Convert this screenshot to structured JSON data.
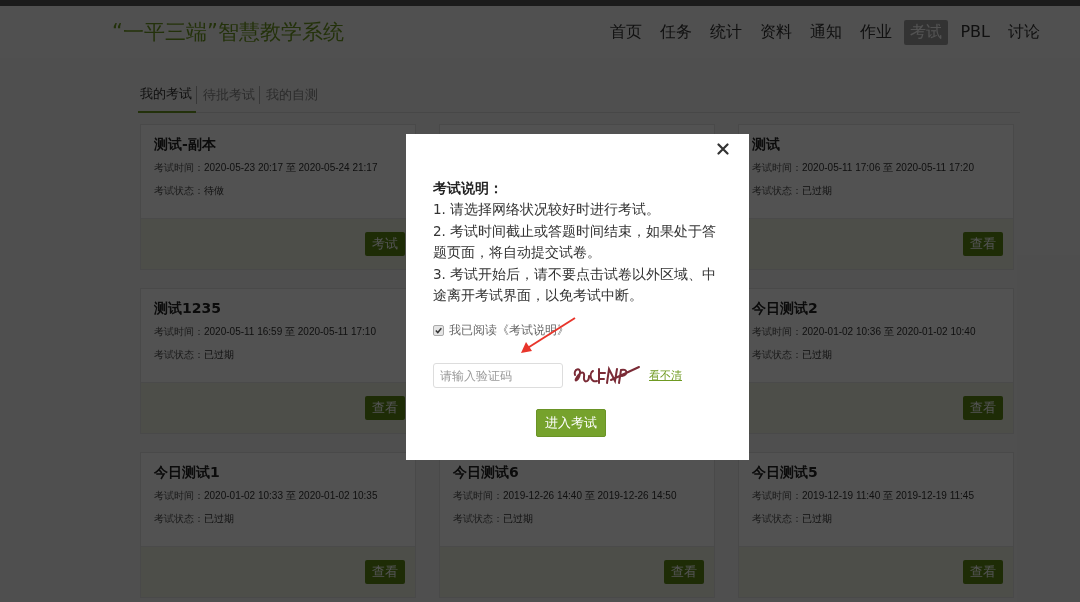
{
  "header": {
    "logo": "“一平三端”智慧教学系统",
    "nav": [
      {
        "label": "首页",
        "selected": false
      },
      {
        "label": "任务",
        "selected": false
      },
      {
        "label": "统计",
        "selected": false
      },
      {
        "label": "资料",
        "selected": false
      },
      {
        "label": "通知",
        "selected": false
      },
      {
        "label": "作业",
        "selected": false
      },
      {
        "label": "考试",
        "selected": true
      },
      {
        "label": "PBL",
        "selected": false
      },
      {
        "label": "讨论",
        "selected": false
      }
    ]
  },
  "tabs": [
    {
      "label": "我的考试",
      "selected": true
    },
    {
      "label": "待批考试",
      "selected": false
    },
    {
      "label": "我的自测",
      "selected": false
    }
  ],
  "exam_rows": [
    {
      "left": {
        "title": "测试-副本",
        "time_label": "考试时间：",
        "time": "2020-05-23 20:17 至 2020-05-24 21:17",
        "status_label": "考试状态：",
        "status": "待做",
        "button": "考试"
      },
      "right": {
        "title": "测试",
        "time_label": "考试时间：",
        "time": "2020-05-11 17:06 至 2020-05-11 17:20",
        "status_label": "考试状态：",
        "status": "已过期",
        "button": "查看"
      }
    },
    {
      "left": {
        "title": "测试1235",
        "time_label": "考试时间：",
        "time": "2020-05-11 16:59 至 2020-05-11 17:10",
        "status_label": "考试状态：",
        "status": "已过期",
        "button": "查看"
      },
      "right": {
        "title": "今日测试2",
        "time_label": "考试时间：",
        "time": "2020-01-02 10:36 至 2020-01-02 10:40",
        "status_label": "考试状态：",
        "status": "已过期",
        "button": "查看"
      }
    },
    {
      "left": {
        "title": "今日测试1",
        "time_label": "考试时间：",
        "time": "2020-01-02 10:33 至 2020-01-02 10:35",
        "status_label": "考试状态：",
        "status": "已过期",
        "button": "查看"
      },
      "middle": {
        "title": "今日测试6",
        "time_label": "考试时间：",
        "time": "2019-12-26 14:40 至 2019-12-26 14:50",
        "status_label": "考试状态：",
        "status": "已过期",
        "button": "查看"
      },
      "right": {
        "title": "今日测试5",
        "time_label": "考试时间：",
        "time": "2019-12-19 11:40 至 2019-12-19 11:45",
        "status_label": "考试状态：",
        "status": "已过期",
        "button": "查看"
      }
    }
  ],
  "dialog": {
    "heading": "考试说明：",
    "instructions": [
      "1. 请选择网络状况较好时进行考试。",
      "2. 考试时间截止或答题时间结束，如果处于答题页面，将自动提交试卷。",
      "3. 考试开始后，请不要点击试卷以外区域、中途离开考试界面，以免考试中断。"
    ],
    "agree": {
      "label": "我已阅读《考试说明》",
      "checked": true
    },
    "captcha": {
      "placeholder": "请输入验证码",
      "refresh_link": "看不清"
    },
    "submit": "进入考试"
  }
}
